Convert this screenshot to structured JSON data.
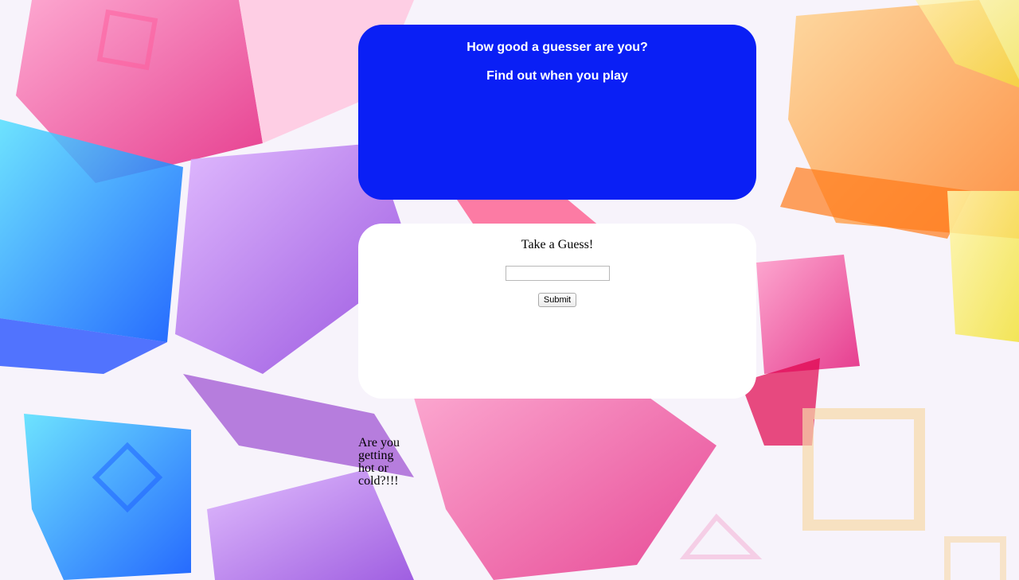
{
  "header": {
    "title": "How good a guesser are you?",
    "subtitle": "Find out when you play"
  },
  "guess_form": {
    "prompt": "Take a Guess!",
    "input_value": "",
    "input_placeholder": "",
    "submit_label": "Submit"
  },
  "feedback": {
    "message": "Are you getting hot or cold?!!!"
  },
  "colors": {
    "header_background": "#0a1ff5",
    "form_background": "#ffffff",
    "header_text": "#ffffff"
  }
}
